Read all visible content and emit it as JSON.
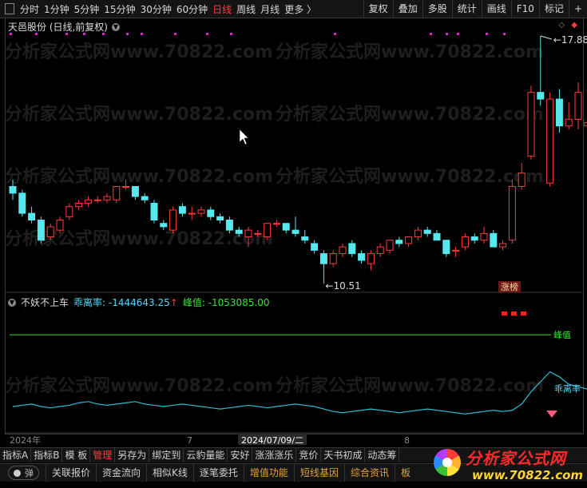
{
  "toolbar": {
    "periods": [
      {
        "label": "分时",
        "active": false
      },
      {
        "label": "1分钟",
        "active": false
      },
      {
        "label": "5分钟",
        "active": false
      },
      {
        "label": "15分钟",
        "active": false
      },
      {
        "label": "30分钟",
        "active": false
      },
      {
        "label": "60分钟",
        "active": false
      },
      {
        "label": "日线",
        "active": true
      },
      {
        "label": "周线",
        "active": false
      },
      {
        "label": "月线",
        "active": false
      },
      {
        "label": "更多 〉",
        "active": false
      }
    ],
    "buttons": [
      "复权",
      "叠加",
      "多股",
      "统计",
      "画线",
      "F10",
      "标记",
      "+"
    ]
  },
  "main": {
    "title": "天邑股份 (日线,前复权)",
    "high_label": "17.88",
    "low_label": "10.51",
    "badge": "涨榜",
    "watermark": "分析家公式网www.70822.com"
  },
  "indicator": {
    "name": "不妖不上车",
    "label1": "乖离率:",
    "value1": "-1444643.25",
    "arrow": "↑",
    "label2": "峰值:",
    "value2": "-1053085.00",
    "line_label": "峰值",
    "series_label": "乖离率"
  },
  "xaxis": {
    "labels": [
      "2024年",
      "7",
      "2024/07/09/二",
      "8"
    ]
  },
  "bottom_tabs": [
    {
      "label": "指标A",
      "active": false
    },
    {
      "label": "指标B",
      "active": false
    },
    {
      "label": "模 板",
      "active": false
    },
    {
      "label": "管理",
      "active": true
    },
    {
      "label": "另存为",
      "active": false
    },
    {
      "label": "绑定到",
      "active": false
    },
    {
      "label": "云豹量能",
      "active": false
    },
    {
      "label": "安好",
      "active": false
    },
    {
      "label": "涨涨涨乐",
      "active": false
    },
    {
      "label": "竞价",
      "active": false
    },
    {
      "label": "天书初成",
      "active": false
    },
    {
      "label": "动态筹",
      "active": false
    }
  ],
  "bottom_bar": {
    "toggle_label": "弹",
    "items": [
      {
        "label": "关联报价",
        "gold": false
      },
      {
        "label": "资金流向",
        "gold": false
      },
      {
        "label": "相似K线",
        "gold": false
      },
      {
        "label": "逐笔委托",
        "gold": false
      },
      {
        "label": "增值功能",
        "gold": true
      },
      {
        "label": "短线基因",
        "gold": true
      },
      {
        "label": "综合资讯",
        "gold": true
      },
      {
        "label": "板",
        "gold": true
      }
    ]
  },
  "logo": {
    "line1": "分析家公式网",
    "line2": "www.70822.com"
  },
  "colors": {
    "up": "#ff3b3b",
    "down": "#55e8ee",
    "line": "#33e633",
    "text": "#cccccc",
    "bg": "#000000"
  },
  "chart_data": {
    "type": "candlestick",
    "candles": [
      [
        13.4,
        13.6,
        13.0,
        13.2
      ],
      [
        13.2,
        13.3,
        12.5,
        12.6
      ],
      [
        12.6,
        12.8,
        12.3,
        12.4
      ],
      [
        12.4,
        12.5,
        11.7,
        11.8
      ],
      [
        11.9,
        12.3,
        11.8,
        12.2
      ],
      [
        12.1,
        12.5,
        12.0,
        12.4
      ],
      [
        12.5,
        12.9,
        12.4,
        12.8
      ],
      [
        12.8,
        13.0,
        12.7,
        12.9
      ],
      [
        12.9,
        13.1,
        12.8,
        13.0
      ],
      [
        13.0,
        13.1,
        12.9,
        13.0
      ],
      [
        13.0,
        13.2,
        12.9,
        13.1
      ],
      [
        13.0,
        13.4,
        12.9,
        13.4
      ],
      [
        13.4,
        13.6,
        13.3,
        13.4
      ],
      [
        13.4,
        13.4,
        13.0,
        13.1
      ],
      [
        13.1,
        13.2,
        12.9,
        13.0
      ],
      [
        12.9,
        13.0,
        12.3,
        12.4
      ],
      [
        12.3,
        12.4,
        12.1,
        12.2
      ],
      [
        12.1,
        12.8,
        12.0,
        12.7
      ],
      [
        12.8,
        12.9,
        12.5,
        12.6
      ],
      [
        12.6,
        12.8,
        12.4,
        12.6
      ],
      [
        12.6,
        12.8,
        12.5,
        12.7
      ],
      [
        12.7,
        12.8,
        12.4,
        12.5
      ],
      [
        12.5,
        12.6,
        12.3,
        12.4
      ],
      [
        12.4,
        12.5,
        12.0,
        12.1
      ],
      [
        12.1,
        12.2,
        11.9,
        12.0
      ],
      [
        11.9,
        12.2,
        11.6,
        12.1
      ],
      [
        12.0,
        12.1,
        11.9,
        12.0
      ],
      [
        11.9,
        12.3,
        11.8,
        12.3
      ],
      [
        12.3,
        12.4,
        12.2,
        12.3
      ],
      [
        12.3,
        12.3,
        12.0,
        12.1
      ],
      [
        12.1,
        12.5,
        11.9,
        12.0
      ],
      [
        11.9,
        12.1,
        11.7,
        11.8
      ],
      [
        11.7,
        11.8,
        11.4,
        11.5
      ],
      [
        11.4,
        11.5,
        10.51,
        11.1
      ],
      [
        11.1,
        11.5,
        11.0,
        11.4
      ],
      [
        11.4,
        11.7,
        11.3,
        11.6
      ],
      [
        11.7,
        11.8,
        11.3,
        11.4
      ],
      [
        11.4,
        11.5,
        11.1,
        11.2
      ],
      [
        11.1,
        11.5,
        10.9,
        11.4
      ],
      [
        11.4,
        11.7,
        11.3,
        11.6
      ],
      [
        11.5,
        11.8,
        11.4,
        11.8
      ],
      [
        11.8,
        11.9,
        11.6,
        11.7
      ],
      [
        11.7,
        11.9,
        11.6,
        11.9
      ],
      [
        11.9,
        12.2,
        11.8,
        12.1
      ],
      [
        12.1,
        12.2,
        11.9,
        12.0
      ],
      [
        12.0,
        12.1,
        11.8,
        11.8
      ],
      [
        11.8,
        11.8,
        11.3,
        11.4
      ],
      [
        11.5,
        11.6,
        11.3,
        11.5
      ],
      [
        11.6,
        12.0,
        11.5,
        11.9
      ],
      [
        11.9,
        12.0,
        11.7,
        11.8
      ],
      [
        11.8,
        12.2,
        11.7,
        12.0
      ],
      [
        12.0,
        12.1,
        11.6,
        11.6
      ],
      [
        11.6,
        11.8,
        11.5,
        11.7
      ],
      [
        11.8,
        13.6,
        11.7,
        13.4
      ],
      [
        13.4,
        14.1,
        13.3,
        13.8
      ],
      [
        14.3,
        16.4,
        14.2,
        16.2
      ],
      [
        16.2,
        17.88,
        15.8,
        16.0
      ],
      [
        13.5,
        16.2,
        13.4,
        16.0
      ],
      [
        16.0,
        16.3,
        15.0,
        15.2
      ],
      [
        15.2,
        15.9,
        15.1,
        15.4
      ],
      [
        15.4,
        16.5,
        15.1,
        16.2
      ],
      [
        15.2,
        16.0,
        14.9,
        15.3
      ]
    ],
    "deviation": [
      20,
      21,
      22,
      20,
      19,
      20,
      21,
      23,
      24,
      22,
      21,
      22,
      23,
      24,
      22,
      21,
      20,
      21,
      22,
      21,
      20,
      19,
      18,
      19,
      20,
      21,
      20,
      19,
      20,
      21,
      22,
      21,
      20,
      18,
      16,
      15,
      16,
      17,
      18,
      17,
      16,
      15,
      16,
      17,
      18,
      17,
      16,
      15,
      14,
      15,
      16,
      17,
      16,
      17,
      22,
      32,
      40,
      48,
      44,
      38,
      36,
      34
    ],
    "peak_line": 78
  }
}
